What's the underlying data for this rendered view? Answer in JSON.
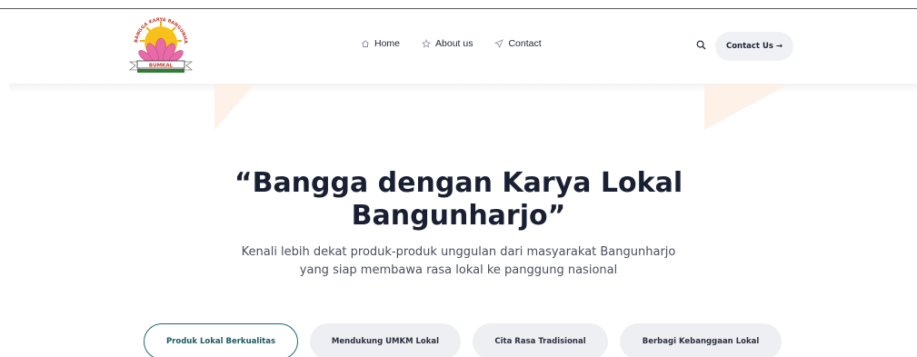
{
  "brand": {
    "logo_text_top": "BANGGA KARYA BANGUNHARJO",
    "logo_text_banner": "BUMKAL"
  },
  "nav": {
    "items": [
      {
        "label": "Home",
        "icon": "home-icon"
      },
      {
        "label": "About us",
        "icon": "star-icon"
      },
      {
        "label": "Contact",
        "icon": "send-icon"
      }
    ]
  },
  "header_actions": {
    "search_icon": "search-icon",
    "contact_button": "Contact Us →"
  },
  "hero": {
    "title_line1": "“Bangga dengan Karya Lokal",
    "title_line2": "Bangunharjo”",
    "subtitle_line1": "Kenali lebih dekat produk-produk unggulan dari masyarakat Bangunharjo",
    "subtitle_line2": "yang siap membawa rasa lokal ke panggung nasional"
  },
  "pills": [
    {
      "label": "Produk Lokal Berkualitas",
      "active": true
    },
    {
      "label": "Mendukung UMKM Lokal",
      "active": false
    },
    {
      "label": "Cita Rasa Tradisional",
      "active": false
    },
    {
      "label": "Berbagi Kebanggaan Lokal",
      "active": false
    }
  ],
  "colors": {
    "accent_teal": "#1f6870",
    "text_dark": "#1a2033",
    "pill_bg": "#eeeff2",
    "deco_peach": "#fdf1e8"
  }
}
